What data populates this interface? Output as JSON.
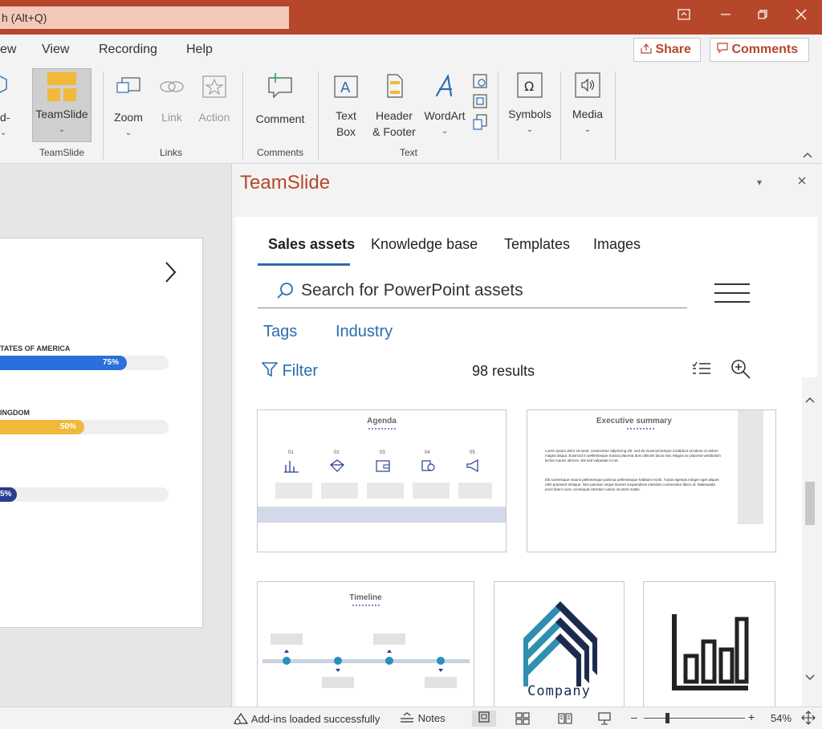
{
  "titlebar": {
    "search_text": "h (Alt+Q)"
  },
  "menu": {
    "tabs": [
      "ew",
      "View",
      "Recording",
      "Help"
    ],
    "share_label": "Share",
    "comments_label": "Comments"
  },
  "ribbon": {
    "partial_button_label": "d-",
    "teamslide_label": "TeamSlide",
    "zoom_label": "Zoom",
    "link_label": "Link",
    "action_label": "Action",
    "comment_label": "Comment",
    "textbox_line1": "Text",
    "textbox_line2": "Box",
    "header_line1": "Header",
    "header_line2": "& Footer",
    "wordart_label": "WordArt",
    "symbols_label": "Symbols",
    "media_label": "Media",
    "groups": {
      "teamslide": "TeamSlide",
      "links": "Links",
      "comments": "Comments",
      "text": "Text"
    }
  },
  "slide": {
    "bars": [
      {
        "label": "TATES OF AMERICA",
        "value_text": "75%",
        "value": 0.75,
        "color": "#2a6fdb"
      },
      {
        "label": "INGDOM",
        "value_text": "50%",
        "value": 0.5,
        "color": "#f0b93a"
      },
      {
        "label": "",
        "value_text": "5%",
        "value": 0.1,
        "color": "#2a3c8f"
      }
    ]
  },
  "pane": {
    "title": "TeamSlide",
    "tabs": [
      "Sales assets",
      "Knowledge base",
      "Templates",
      "Images"
    ],
    "search_placeholder": "Search for PowerPoint assets",
    "tags_label": "Tags",
    "industry_label": "Industry",
    "filter_label": "Filter",
    "results_text": "98 results",
    "cards": {
      "agenda": {
        "title": "Agenda",
        "numbers": [
          "01",
          "02",
          "03",
          "04",
          "05"
        ]
      },
      "executive": {
        "title": "Executive summary",
        "para1": "Lorem ipsum dolor sit amet, consectetur adipiscing elit, sed do eiusmod tempor incididunt ut labore et dolore magna aliqua. Euismod in pellentesque massa placerat duis ultricies lacus sed. Magna ac placerat vestibulum lectus mauris ultrices. Elit sed vulputate mi sit.",
        "para2": "Elit scelerisque mauris pellentesque pulvinar pellentesque habitant morbi. Turpis egestas integer eget aliquet nibh praesent tristique. Non pulvinar neque laoreet suspendisse interdum consectetur libero id. Malesuada proin libero nunc consequat interdum varius sit amet mattis."
      },
      "timeline": {
        "title": "Timeline"
      },
      "company": {
        "label": "Company"
      }
    }
  },
  "status": {
    "addins": "Add-ins loaded successfully",
    "notes": "Notes",
    "zoom": "54%"
  }
}
